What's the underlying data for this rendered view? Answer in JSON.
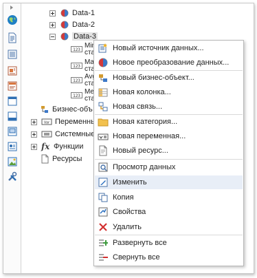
{
  "tree": {
    "data1": "Data-1",
    "data2": "Data-2",
    "data3": "Data-3",
    "fields": [
      {
        "line1": "Min",
        "line2": "ста"
      },
      {
        "line1": "Ma",
        "line2": "ста"
      },
      {
        "line1": "Avg",
        "line2": "ста"
      },
      {
        "line1": "Me",
        "line2": "ста"
      }
    ],
    "field_type": "123",
    "business": "Бизнес-объ",
    "variables": "Переменны",
    "system": "Системные",
    "functions": "Функции",
    "functions_glyph": "fx",
    "resources": "Ресурсы"
  },
  "menu": {
    "items": [
      {
        "label": "Новый источник данных...",
        "icon": "new-datasource-icon"
      },
      {
        "label": "Новое преобразование данных...",
        "icon": "new-transform-icon"
      },
      {
        "label": "Новый бизнес-объект...",
        "icon": "new-business-object-icon"
      },
      {
        "label": "Новая колонка...",
        "icon": "new-column-icon"
      },
      {
        "label": "Новая связь...",
        "icon": "new-relation-icon"
      },
      {
        "label": "Новая категория...",
        "icon": "new-category-icon"
      },
      {
        "label": "Новая переменная...",
        "icon": "new-variable-icon"
      },
      {
        "label": "Новый ресурс...",
        "icon": "new-resource-icon"
      },
      {
        "label": "Просмотр данных",
        "icon": "view-data-icon"
      },
      {
        "label": "Изменить",
        "icon": "edit-icon"
      },
      {
        "label": "Копия",
        "icon": "copy-icon"
      },
      {
        "label": "Свойства",
        "icon": "properties-icon"
      },
      {
        "label": "Удалить",
        "icon": "delete-icon"
      },
      {
        "label": "Развернуть все",
        "icon": "expand-all-icon"
      },
      {
        "label": "Свернуть все",
        "icon": "collapse-all-icon"
      }
    ],
    "highlighted": "Изменить"
  },
  "colors": {
    "hover": "#e8eef7",
    "accent_blue": "#2a6fbf",
    "delete_red": "#d32f2f"
  }
}
